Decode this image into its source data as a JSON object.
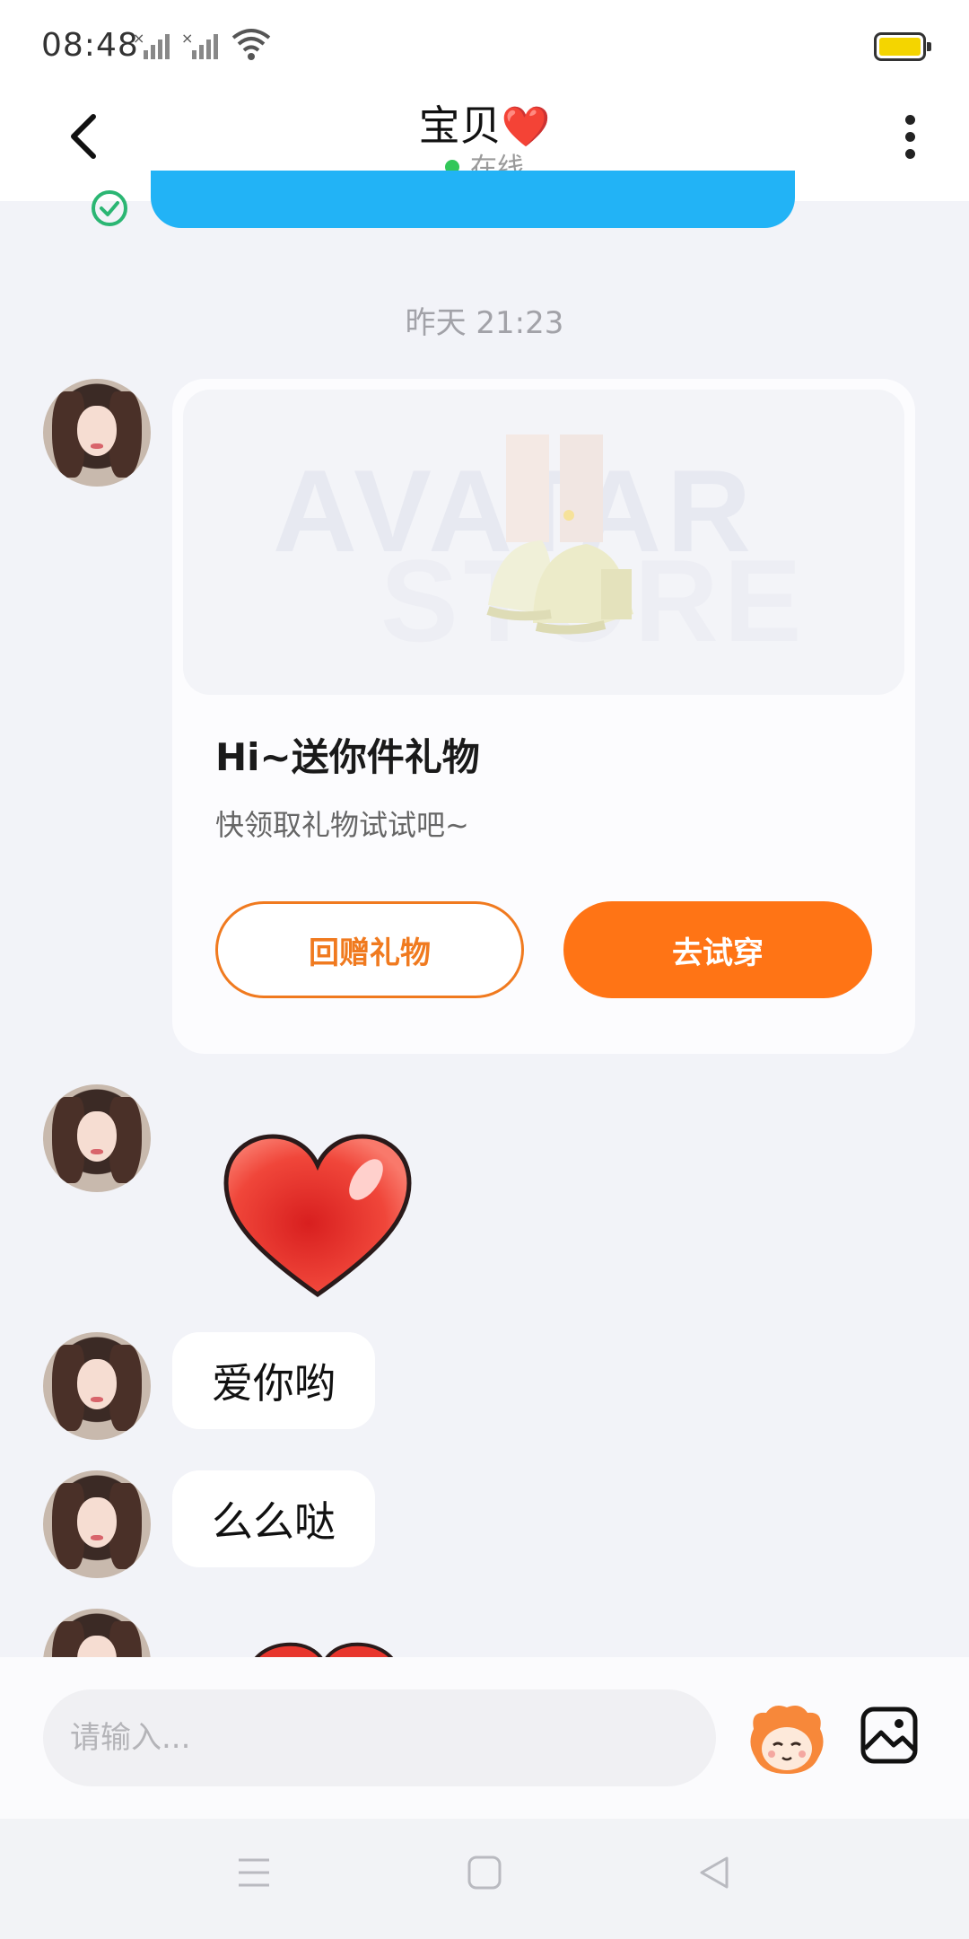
{
  "status_bar": {
    "time": "08:48",
    "icons": [
      "signal-x-icon",
      "signal-x-icon",
      "wifi-icon",
      "battery-icon"
    ],
    "battery_color": "#f4d500"
  },
  "header": {
    "title": "宝贝",
    "title_emoji": "❤️",
    "presence": "在线",
    "presence_color": "#32c759",
    "icons": [
      "back-arrow-icon",
      "more-vertical-icon"
    ]
  },
  "messages": {
    "previous_bubble_color": "#22b3f6",
    "timestamp": "昨天 21:23",
    "gift_card": {
      "image_watermark": [
        "AVATAR",
        "STORE"
      ],
      "title": "Hi~送你件礼物",
      "subtitle": "快领取礼物试试吧~",
      "return_gift_label": "回赠礼物",
      "try_on_label": "去试穿",
      "accent_color": "#ff7415"
    },
    "sticker": "heart-sticker",
    "texts": [
      "爱你哟",
      "么么哒"
    ]
  },
  "composer": {
    "placeholder": "请输入...",
    "icons": [
      "emoji-mascot-icon",
      "image-icon"
    ]
  },
  "nav_bar": {
    "icons": [
      "menu-icon",
      "home-icon",
      "back-icon"
    ]
  }
}
